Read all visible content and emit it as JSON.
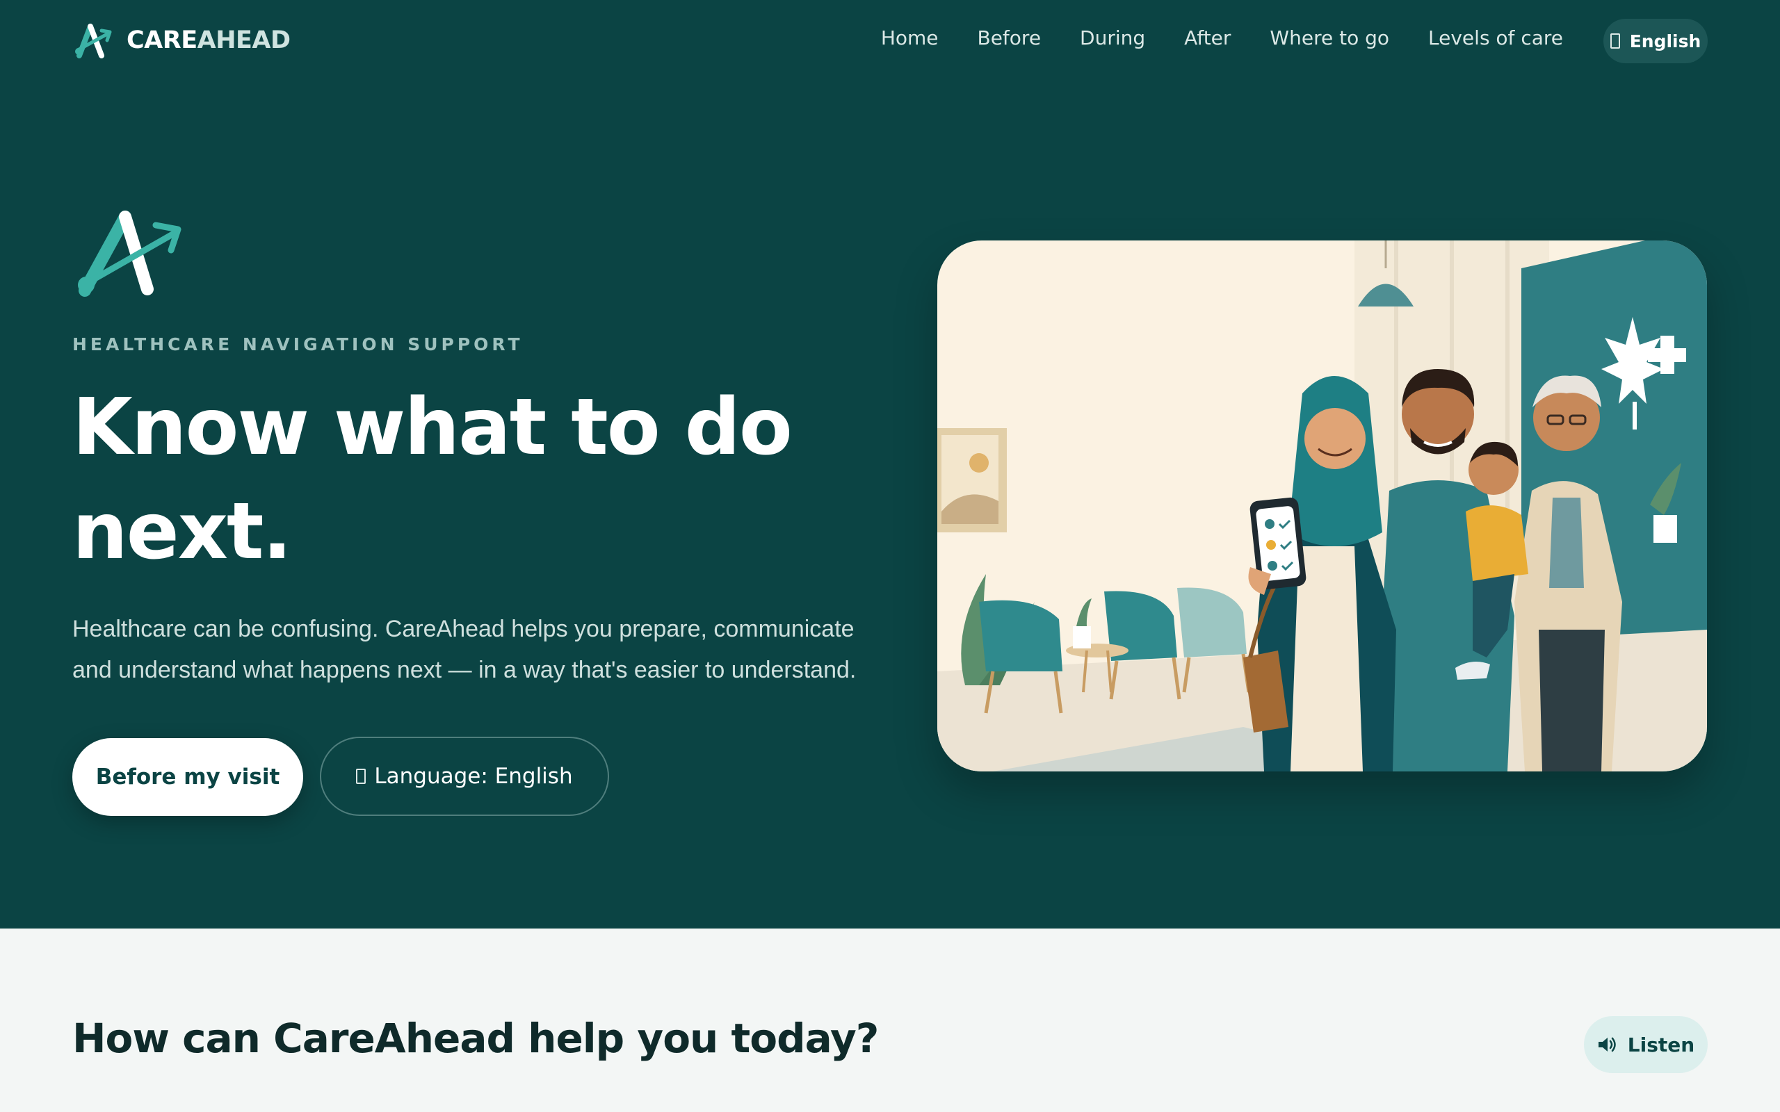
{
  "brand": {
    "name_part1": "CARE",
    "name_part2": "AHEAD"
  },
  "nav": {
    "links": [
      "Home",
      "Before",
      "During",
      "After",
      "Where to go",
      "Levels of care"
    ],
    "language_label": "English"
  },
  "hero": {
    "eyebrow": "HEALTHCARE NAVIGATION SUPPORT",
    "headline": "Know what to do next.",
    "subtext": "Healthcare can be confusing. CareAhead helps you prepare, communicate and understand what happens next — in a way that's easier to understand.",
    "primary_button": "Before my visit",
    "secondary_button": "Language: English"
  },
  "section": {
    "title": "How can CareAhead help you today?",
    "listen_label": "Listen"
  },
  "icons": {
    "logo": "careahead-logo-icon",
    "globe": "globe-icon",
    "speaker": "speaker-icon"
  },
  "colors": {
    "hero_bg": "#0b4444",
    "accent_teal": "#3bb3a6",
    "page_bg": "#f3f6f5",
    "pill_bg": "#1c5656",
    "listen_bg": "#dcefed"
  }
}
